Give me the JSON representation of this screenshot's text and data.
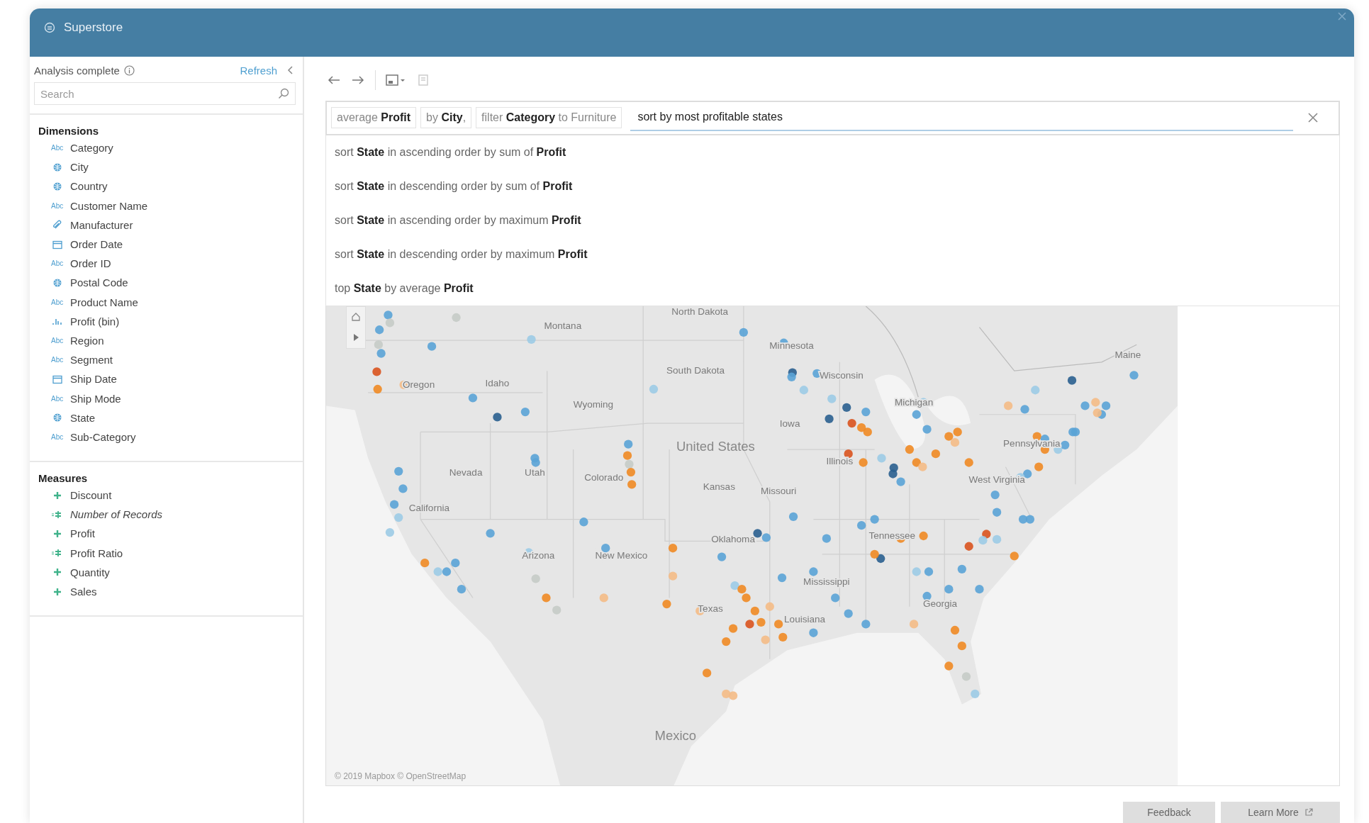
{
  "window": {
    "title": "Superstore"
  },
  "sidebar": {
    "status": "Analysis complete",
    "refresh": "Refresh",
    "search": {
      "placeholder": "Search"
    },
    "sections": [
      {
        "title": "Dimensions",
        "items": [
          {
            "label": "Category",
            "kind": "string",
            "icon_text": "Abc",
            "italic": false
          },
          {
            "label": "City",
            "kind": "geo",
            "italic": false
          },
          {
            "label": "Country",
            "kind": "geo",
            "italic": false
          },
          {
            "label": "Customer Name",
            "kind": "string",
            "icon_text": "Abc",
            "italic": false
          },
          {
            "label": "Manufacturer",
            "kind": "group",
            "italic": false
          },
          {
            "label": "Order Date",
            "kind": "date",
            "italic": false
          },
          {
            "label": "Order ID",
            "kind": "string",
            "icon_text": "Abc",
            "italic": false
          },
          {
            "label": "Postal Code",
            "kind": "geo",
            "italic": false
          },
          {
            "label": "Product Name",
            "kind": "string",
            "icon_text": "Abc",
            "italic": false
          },
          {
            "label": "Profit (bin)",
            "kind": "bin",
            "italic": false
          },
          {
            "label": "Region",
            "kind": "string",
            "icon_text": "Abc",
            "italic": false
          },
          {
            "label": "Segment",
            "kind": "string",
            "icon_text": "Abc",
            "italic": false
          },
          {
            "label": "Ship Date",
            "kind": "date",
            "italic": false
          },
          {
            "label": "Ship Mode",
            "kind": "string",
            "icon_text": "Abc",
            "italic": false
          },
          {
            "label": "State",
            "kind": "geo",
            "italic": false
          },
          {
            "label": "Sub-Category",
            "kind": "string",
            "icon_text": "Abc",
            "italic": false
          }
        ]
      },
      {
        "title": "Measures",
        "items": [
          {
            "label": "Discount",
            "kind": "number",
            "italic": false
          },
          {
            "label": "Number of Records",
            "kind": "calc",
            "italic": true
          },
          {
            "label": "Profit",
            "kind": "number",
            "italic": false
          },
          {
            "label": "Profit Ratio",
            "kind": "calc",
            "italic": false
          },
          {
            "label": "Quantity",
            "kind": "number",
            "italic": false
          },
          {
            "label": "Sales",
            "kind": "number",
            "italic": false
          }
        ]
      }
    ]
  },
  "query": {
    "pills": [
      "average **Profit**",
      "by **City**,",
      "filter **Category** to Furniture"
    ],
    "value": "sort by most profitable states"
  },
  "suggestions": [
    "sort **State** in ascending order by sum of **Profit**",
    "sort **State** in descending order by sum of **Profit**",
    "sort **State** in ascending order by maximum **Profit**",
    "sort **State** in descending order by maximum **Profit**",
    "top **State** by average **Profit**"
  ],
  "map": {
    "labels": [
      {
        "text": "North Dakota",
        "kind": "state"
      },
      {
        "text": "Montana",
        "kind": "state"
      },
      {
        "text": "Minnesota",
        "kind": "state"
      },
      {
        "text": "South Dakota",
        "kind": "state"
      },
      {
        "text": "Wisconsin",
        "kind": "state"
      },
      {
        "text": "Oregon",
        "kind": "state"
      },
      {
        "text": "Idaho",
        "kind": "state"
      },
      {
        "text": "Wyoming",
        "kind": "state"
      },
      {
        "text": "Michigan",
        "kind": "state"
      },
      {
        "text": "Iowa",
        "kind": "state"
      },
      {
        "text": "Pennsylvania",
        "kind": "state"
      },
      {
        "text": "Maine",
        "kind": "state"
      },
      {
        "text": "United States",
        "kind": "country"
      },
      {
        "text": "Illinois",
        "kind": "state"
      },
      {
        "text": "Nevada",
        "kind": "state"
      },
      {
        "text": "Utah",
        "kind": "state"
      },
      {
        "text": "Colorado",
        "kind": "state"
      },
      {
        "text": "Kansas",
        "kind": "state"
      },
      {
        "text": "Missouri",
        "kind": "state"
      },
      {
        "text": "West Virginia",
        "kind": "state"
      },
      {
        "text": "California",
        "kind": "state"
      },
      {
        "text": "Oklahoma",
        "kind": "state"
      },
      {
        "text": "Tennessee",
        "kind": "state"
      },
      {
        "text": "Arizona",
        "kind": "state"
      },
      {
        "text": "New Mexico",
        "kind": "state"
      },
      {
        "text": "Mississippi",
        "kind": "state"
      },
      {
        "text": "Georgia",
        "kind": "state"
      },
      {
        "text": "Texas",
        "kind": "state"
      },
      {
        "text": "Louisiana",
        "kind": "state"
      },
      {
        "text": "Mexico",
        "kind": "country"
      }
    ],
    "attribution": "© 2019 Mapbox © OpenStreetMap"
  },
  "footer": {
    "buttons": [
      "Feedback",
      "Learn More"
    ]
  }
}
